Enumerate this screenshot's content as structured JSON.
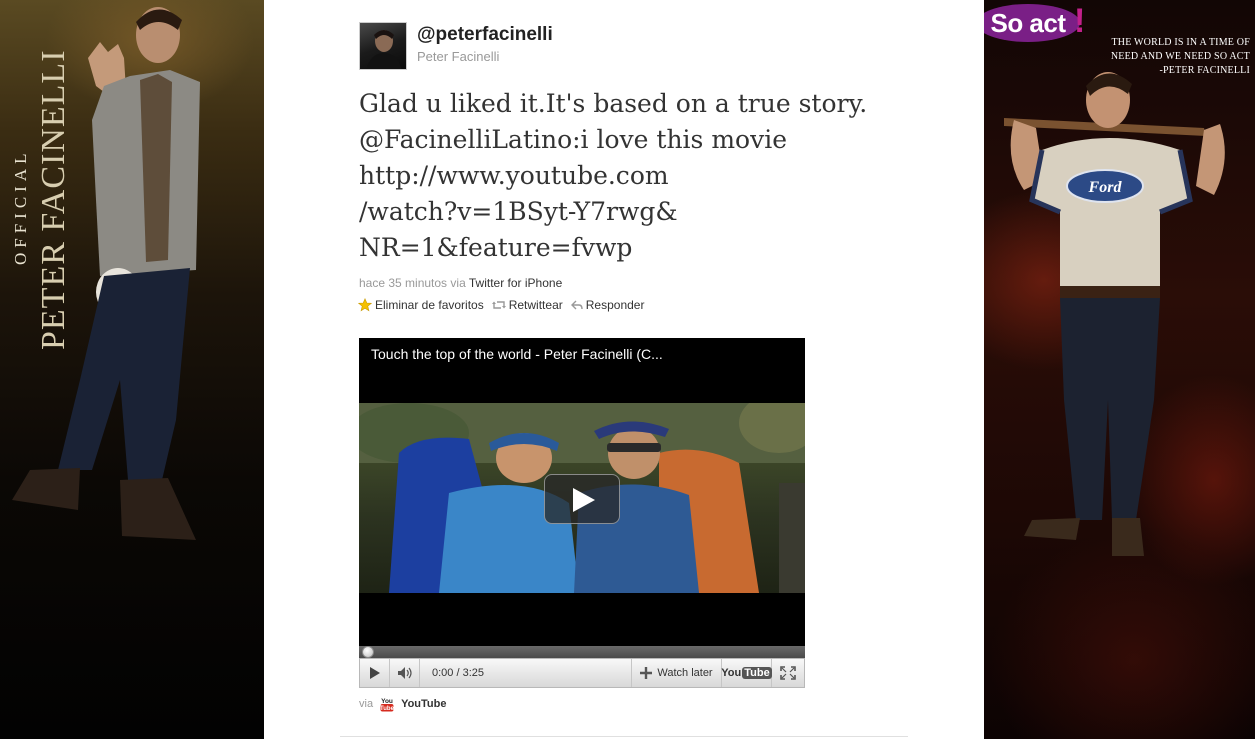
{
  "left_art": {
    "official": "OFFICIAL",
    "name": "PETER FACINELLI"
  },
  "right_art": {
    "so_act": "So act",
    "so_act_bang": "!",
    "quote_lines": [
      "THE WORLD IS IN A TIME OF",
      "NEED AND WE NEED SO ACT",
      "-PETER FACINELLI"
    ],
    "shirt_logo": "Ford"
  },
  "tweet": {
    "username": "@peterfacinelli",
    "fullname": "Peter Facinelli",
    "text_lines": [
      "Glad u liked it.It's based on a true story.",
      "@FacinelliLatino:i love this movie",
      "http://www.youtube.com",
      "/watch?v=1BSyt-Y7rwg&",
      "NR=1&feature=fvwp"
    ],
    "time": "hace 35 minutos",
    "via": "via",
    "source": "Twitter for iPhone",
    "actions": {
      "unfavorite": "Eliminar de favoritos",
      "retweet": "Retwittear",
      "reply": "Responder"
    }
  },
  "player": {
    "title": "Touch the top of the world - Peter Facinelli (C...",
    "time": "0:00 / 3:25",
    "watch_later": "Watch later",
    "yt_you": "You",
    "yt_tube": "Tube"
  },
  "footer": {
    "via": "via",
    "provider": "YouTube"
  },
  "colors": {
    "so_act_bg": "#7a1f86",
    "text_dark": "#333333",
    "meta_gray": "#999999"
  }
}
